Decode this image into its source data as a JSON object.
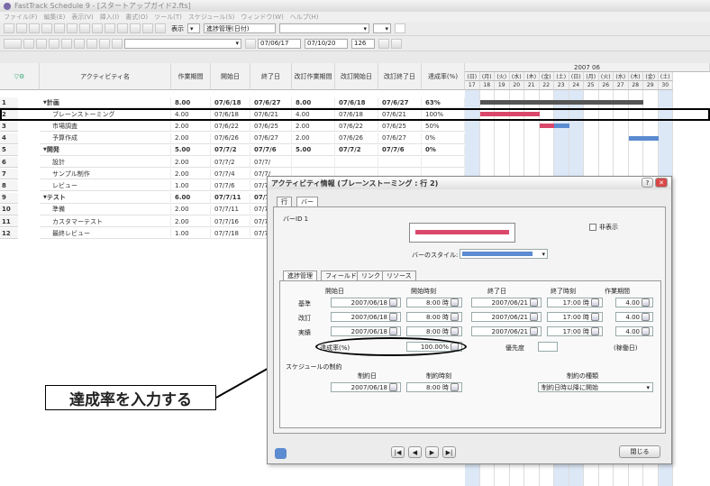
{
  "app": {
    "title": "FastTrack Schedule 9 - [スタートアップガイド2.fts]",
    "menus": [
      "ファイル(F)",
      "編集(E)",
      "表示(V)",
      "挿入(I)",
      "書式(O)",
      "ツール(T)",
      "スケジュール(S)",
      "ウィンドウ(W)",
      "ヘルプ(H)"
    ]
  },
  "toolbar": {
    "view_label": "表示",
    "layout_select": "進捗管理(日付)",
    "date_from": "07/06/17",
    "date_to": "07/10/20",
    "zoom": "126"
  },
  "columns": [
    "アクティビティ名",
    "作業期間",
    "開始日",
    "終了日",
    "改訂作業期間",
    "改訂開始日",
    "改訂終了日",
    "達成率(%)"
  ],
  "rows": [
    {
      "num": "1",
      "name": "計画",
      "dur": "8.00",
      "start": "07/6/18",
      "end": "07/6/27",
      "rdur": "8.00",
      "rstart": "07/6/18",
      "rend": "07/6/27",
      "pct": "63%",
      "bold": true,
      "indent": 0
    },
    {
      "num": "2",
      "name": "ブレーンストーミング",
      "dur": "4.00",
      "start": "07/6/18",
      "end": "07/6/21",
      "rdur": "4.00",
      "rstart": "07/6/18",
      "rend": "07/6/21",
      "pct": "100%",
      "bold": false,
      "indent": 1
    },
    {
      "num": "3",
      "name": "市場調査",
      "dur": "2.00",
      "start": "07/6/22",
      "end": "07/6/25",
      "rdur": "2.00",
      "rstart": "07/6/22",
      "rend": "07/6/25",
      "pct": "50%",
      "bold": false,
      "indent": 1
    },
    {
      "num": "4",
      "name": "予算作成",
      "dur": "2.00",
      "start": "07/6/26",
      "end": "07/6/27",
      "rdur": "2.00",
      "rstart": "07/6/26",
      "rend": "07/6/27",
      "pct": "0%",
      "bold": false,
      "indent": 1
    },
    {
      "num": "5",
      "name": "開発",
      "dur": "5.00",
      "start": "07/7/2",
      "end": "07/7/6",
      "rdur": "5.00",
      "rstart": "07/7/2",
      "rend": "07/7/6",
      "pct": "0%",
      "bold": true,
      "indent": 0
    },
    {
      "num": "6",
      "name": "設計",
      "dur": "2.00",
      "start": "07/7/2",
      "end": "07/7/",
      "rdur": "",
      "rstart": "",
      "rend": "",
      "pct": "",
      "bold": false,
      "indent": 1
    },
    {
      "num": "7",
      "name": "サンプル制作",
      "dur": "2.00",
      "start": "07/7/4",
      "end": "07/7/",
      "rdur": "",
      "rstart": "",
      "rend": "",
      "pct": "",
      "bold": false,
      "indent": 1
    },
    {
      "num": "8",
      "name": "レビュー",
      "dur": "1.00",
      "start": "07/7/6",
      "end": "07/7/",
      "rdur": "",
      "rstart": "",
      "rend": "",
      "pct": "",
      "bold": false,
      "indent": 1
    },
    {
      "num": "9",
      "name": "テスト",
      "dur": "6.00",
      "start": "07/7/11",
      "end": "07/7/",
      "rdur": "",
      "rstart": "",
      "rend": "",
      "pct": "",
      "bold": true,
      "indent": 0
    },
    {
      "num": "10",
      "name": "準備",
      "dur": "2.00",
      "start": "07/7/11",
      "end": "07/7/",
      "rdur": "",
      "rstart": "",
      "rend": "",
      "pct": "",
      "bold": false,
      "indent": 1
    },
    {
      "num": "11",
      "name": "カスタマーテスト",
      "dur": "2.00",
      "start": "07/7/16",
      "end": "07/7/",
      "rdur": "",
      "rstart": "",
      "rend": "",
      "pct": "",
      "bold": false,
      "indent": 1
    },
    {
      "num": "12",
      "name": "最終レビュー",
      "dur": "1.00",
      "start": "07/7/18",
      "end": "07/7/",
      "rdur": "",
      "rstart": "",
      "rend": "",
      "pct": "",
      "bold": false,
      "indent": 1
    }
  ],
  "gantt": {
    "month": "2007 06",
    "weekdays": [
      "(日)",
      "(月)",
      "(火)",
      "(水)",
      "(木)",
      "(金)",
      "(土)",
      "(日)",
      "(月)",
      "(火)",
      "(水)",
      "(木)",
      "(金)",
      "(土)"
    ],
    "days": [
      "17",
      "18",
      "19",
      "20",
      "21",
      "22",
      "23",
      "24",
      "25",
      "26",
      "27",
      "28",
      "29",
      "30"
    ]
  },
  "dialog": {
    "title": "アクティビティ情報 (ブレーンストーミング : 行 2)",
    "tabs": [
      "行",
      "バー"
    ],
    "bar_id": "バーID 1",
    "hide_label": "非表示",
    "bar_style_label": "バーのスタイル:",
    "subtabs": [
      "進捗管理",
      "フィールド",
      "リンク",
      "リソース"
    ],
    "headers": [
      "開始日",
      "開始時刻",
      "終了日",
      "終了時刻",
      "作業期間"
    ],
    "rows": [
      {
        "label": "基準",
        "sd": "2007/06/18",
        "st": "8:00 時",
        "ed": "2007/06/21",
        "et": "17:00 時",
        "dur": "4.00"
      },
      {
        "label": "改訂",
        "sd": "2007/06/18",
        "st": "8:00 時",
        "ed": "2007/06/21",
        "et": "17:00 時",
        "dur": "4.00"
      },
      {
        "label": "実績",
        "sd": "2007/06/18",
        "st": "8:00 時",
        "ed": "2007/06/21",
        "et": "17:00 時",
        "dur": "4.00"
      }
    ],
    "pct_label": "達成率(%)",
    "pct_value": "100.00%",
    "priority_label": "優先度",
    "unit_label": "(稼働日)",
    "constraint_section": "スケジュールの制約",
    "constraint_headers": [
      "制約日",
      "制約時刻",
      "制約の種類"
    ],
    "constraint_date": "2007/06/18",
    "constraint_time": "8:00 時",
    "constraint_type": "制約日時以降に開始",
    "close_label": "閉じる",
    "nav": [
      "|◀",
      "◀",
      "▶",
      "▶|"
    ]
  },
  "callout": "達成率を入力する",
  "colors": {
    "bar_red": "#d9486a",
    "bar_blue": "#5b8bd0",
    "weekend": "#dde8f7"
  }
}
